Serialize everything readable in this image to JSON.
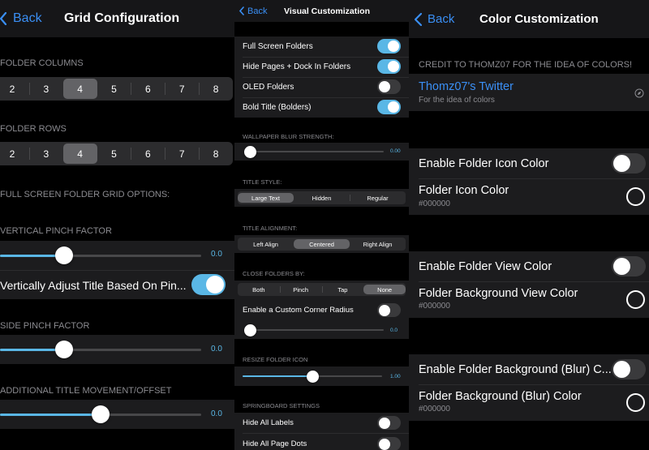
{
  "colors": {
    "accent": "#3a8ff5",
    "switch_on": "#5ab7e6",
    "background": "#000000",
    "cell": "#1c1c1e"
  },
  "grid": {
    "back_label": "Back",
    "title": "Grid Configuration",
    "folder_columns": {
      "header": "FOLDER COLUMNS",
      "options": [
        "2",
        "3",
        "4",
        "5",
        "6",
        "7",
        "8"
      ],
      "selected": "4"
    },
    "folder_rows": {
      "header": "FOLDER ROWS",
      "options": [
        "2",
        "3",
        "4",
        "5",
        "6",
        "7",
        "8"
      ],
      "selected": "4"
    },
    "fullscreen_header": "FULL SCREEN FOLDER GRID OPTIONS:",
    "vertical_pinch": {
      "header": "VERTICAL PINCH FACTOR",
      "value": "0.0",
      "level": 0.3
    },
    "adjust_title": {
      "label": "Vertically Adjust Title Based On Pin...",
      "on": true
    },
    "side_pinch": {
      "header": "SIDE PINCH FACTOR",
      "value": "0.0",
      "level": 0.3
    },
    "title_offset": {
      "header": "ADDITIONAL TITLE MOVEMENT/OFFSET",
      "value": "0.0",
      "level": 0.5
    }
  },
  "visual": {
    "back_label": "Back",
    "title": "Visual Customization",
    "toggles": [
      {
        "label": "Full Screen Folders",
        "on": true
      },
      {
        "label": "Hide Pages + Dock In Folders",
        "on": true
      },
      {
        "label": "OLED Folders",
        "on": false
      },
      {
        "label": "Bold Title (Bolders)",
        "on": true
      }
    ],
    "blur": {
      "header": "WALLPAPER BLUR STRENGTH:",
      "value": "0.00",
      "level": 0.0
    },
    "title_style": {
      "header": "TITLE STYLE:",
      "options": [
        "Large Text",
        "Hidden",
        "Regular"
      ],
      "selected": "Large Text"
    },
    "title_alignment": {
      "header": "TITLE ALIGNMENT:",
      "options": [
        "Left Align",
        "Centered",
        "Right Align"
      ],
      "selected": "Centered"
    },
    "close_folders": {
      "header": "CLOSE FOLDERS BY:",
      "options": [
        "Both",
        "Pinch",
        "Tap",
        "None"
      ],
      "selected": "None"
    },
    "corner_radius": {
      "label": "Enable a Custom Corner Radius",
      "on": false,
      "value": "0.0",
      "level": 0.0
    },
    "resize_icon": {
      "header": "RESIZE FOLDER ICON",
      "value": "1.00",
      "level": 0.5
    },
    "springboard": {
      "header": "SPRINGBOARD SETTINGS",
      "hide_labels": {
        "label": "Hide All Labels",
        "on": false
      },
      "hide_dots": {
        "label": "Hide All Page Dots",
        "on": false
      }
    }
  },
  "color": {
    "back_label": "Back",
    "title": "Color Customization",
    "credit_header": "CREDIT TO THOMZ07 FOR THE IDEA OF COLORS!",
    "twitter": {
      "label": "Thomz07's Twitter",
      "sub": "For the idea of colors",
      "icon": "compass-icon"
    },
    "icon_color": {
      "toggle_label": "Enable Folder Icon Color",
      "on": false,
      "color_label": "Folder Icon Color",
      "hex": "#000000"
    },
    "view_color": {
      "toggle_label": "Enable Folder View Color",
      "on": false,
      "color_label": "Folder Background View Color",
      "hex": "#000000"
    },
    "blur_color": {
      "toggle_label": "Enable Folder Background (Blur) C...",
      "on": false,
      "color_label": "Folder Background (Blur) Color",
      "hex": "#000000"
    }
  }
}
